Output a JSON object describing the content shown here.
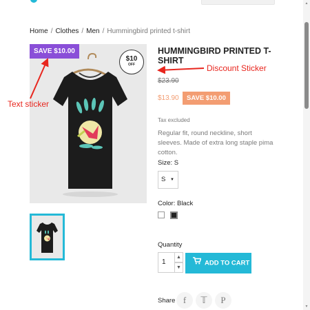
{
  "breadcrumb": {
    "items": [
      "Home",
      "Clothes",
      "Men"
    ],
    "current": "Hummingbird printed t-shirt",
    "separator": "/"
  },
  "product": {
    "title": "Hummingbird printed t-shirt",
    "old_price": "$23.90",
    "new_price": "$13.90",
    "save_badge": "SAVE $10.00",
    "tax_note": "Tax excluded",
    "description": "Regular fit, round neckline, short sleeves. Made of extra long staple pima cotton.",
    "image_icon": "tshirt-image",
    "stickers": {
      "text": "SAVE $10.00",
      "discount_amount": "$10",
      "discount_word": "OFF"
    }
  },
  "options": {
    "size_label": "Size: S",
    "size_value": "S",
    "color_label": "Color: Black",
    "colors": [
      "white",
      "black"
    ]
  },
  "purchase": {
    "quantity_label": "Quantity",
    "quantity_value": "1",
    "add_to_cart_label": "ADD TO CART"
  },
  "share": {
    "label": "Share",
    "networks": [
      "facebook-icon",
      "x-icon",
      "pinterest-icon"
    ]
  },
  "annotations": {
    "text_sticker": "Text sticker",
    "discount_sticker": "Discount Sticker"
  },
  "colors": {
    "accent": "#24b9d7",
    "sticker_purple": "#8a4fd8",
    "discount_orange": "#f39d72",
    "annotation_red": "#e8261e"
  }
}
